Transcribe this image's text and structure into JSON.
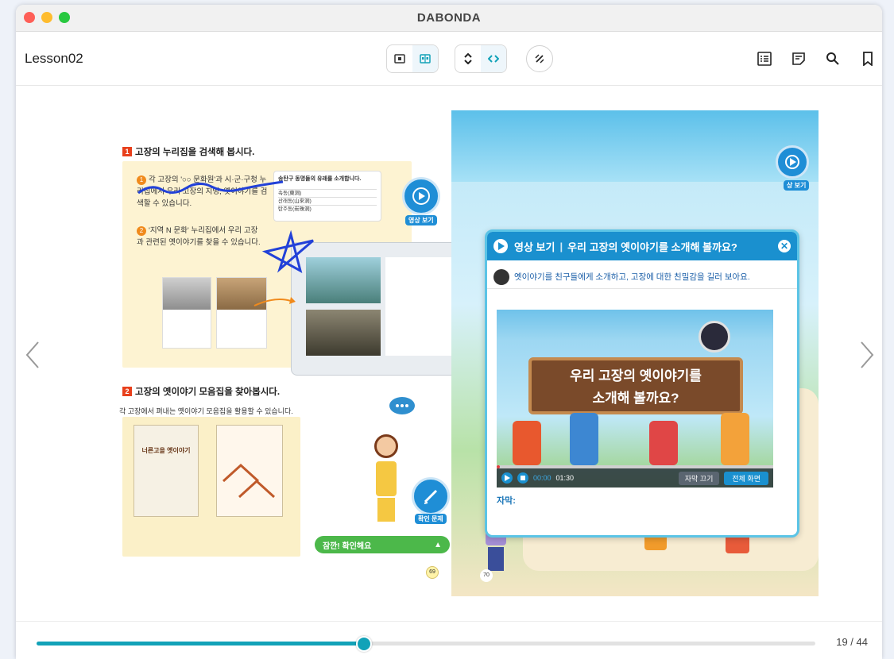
{
  "window": {
    "title": "DABONDA"
  },
  "toolbar": {
    "lesson": "Lesson02"
  },
  "left_page": {
    "sec1_num": "1",
    "sec1_title": "고장의 누리집을 검색해 봅시다.",
    "item1": "각 고장의 '○○ 문화원'과 시·군·구청 누리집에서 우리 고장의 지명, 옛이야기를 검색할 수 있습니다.",
    "item2": "'지역 N 문화' 누리집에서 우리 고장과 관련된 옛이야기를 찾을 수 있습니다.",
    "card_title": "송탄구 동명들의 유래를 소개합니다.",
    "card_rows": [
      "속동(東洞)",
      "산래동(山來洞)",
      "탄주동(炭珠洞)"
    ],
    "video_btn": "영상 보기",
    "sec2_num": "2",
    "sec2_title": "고장의 옛이야기 모음집을 찾아봅시다.",
    "sec2_desc": "각 고장에서 펴내는 옛이야기 모음집을 활용할 수 있습니다.",
    "book_title": "너른고을 옛이야기",
    "check_btn": "확인 문제",
    "wait_label": "잠깐! 확인해요",
    "page_num": "69"
  },
  "right_page": {
    "page_num": "70",
    "video_btn": "상 보기"
  },
  "popup": {
    "header_tag": "영상 보기",
    "header_title": "우리 고장의 옛이야기를 소개해 볼까요?",
    "subtitle": "옛이야기를 친구들에게 소개하고, 고장에 대한 친밀감을 길러 보아요.",
    "video_title_line1": "우리 고장의 옛이야기를",
    "video_title_line2": "소개해 볼까요?",
    "time_current": "00:00",
    "time_total": "01:30",
    "caption_btn": "자막 끄기",
    "fullscreen_btn": "전체 화면",
    "caption_label": "자막:"
  },
  "progress": {
    "current": 19,
    "total": 44,
    "fraction": 0.42,
    "label": "19 / 44"
  },
  "colors": {
    "accent": "#12a2b8",
    "popup_blue": "#1a90cf"
  }
}
